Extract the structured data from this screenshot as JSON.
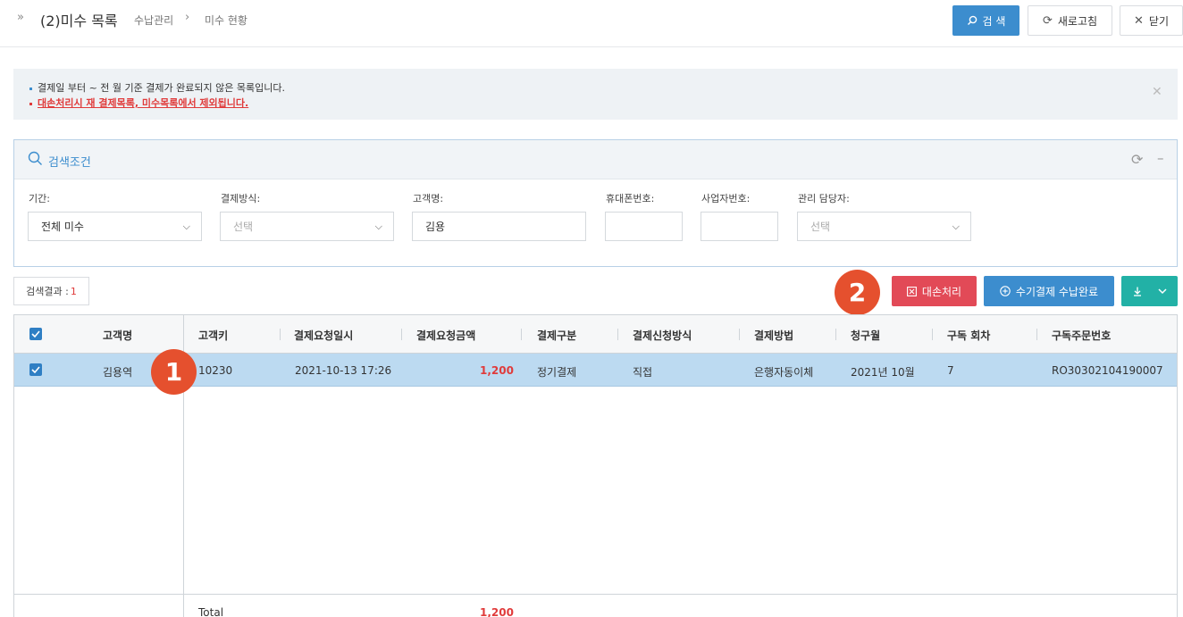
{
  "header": {
    "title": "(2)미수 목록",
    "breadcrumb": [
      "수납관리",
      "미수 현황"
    ],
    "search_label": "검 색",
    "refresh_label": "새로고침",
    "close_label": "닫기"
  },
  "notice": {
    "line1": "결제일 부터 ~ 전 월 기준 결제가 완료되지 않은 목록입니다.",
    "line2": "대손처리시 재 결제목록, 미수목록에서 제외됩니다."
  },
  "search_panel": {
    "title": "검색조건",
    "fields": [
      {
        "label": "기간:",
        "value": "전체 미수",
        "type": "select"
      },
      {
        "label": "결제방식:",
        "value": "선택",
        "type": "select",
        "placeholder": true
      },
      {
        "label": "고객명:",
        "value": "김용",
        "type": "input"
      },
      {
        "label": "휴대폰번호:",
        "value": "",
        "type": "input"
      },
      {
        "label": "사업자번호:",
        "value": "",
        "type": "input"
      },
      {
        "label": "관리 담당자:",
        "value": "선택",
        "type": "select",
        "placeholder": true
      }
    ]
  },
  "results": {
    "count_label": "검색결과 :",
    "count": "1",
    "daeson_label": "대손처리",
    "manual_label": "수기결제 수납완료"
  },
  "badges": [
    "1",
    "2"
  ],
  "grid": {
    "columns": [
      "고객명",
      "고객키",
      "결제요청일시",
      "결제요청금액",
      "결제구분",
      "결제신청방식",
      "결제방법",
      "청구월",
      "구독 회차",
      "구독주문번호"
    ],
    "rows": [
      [
        "김용역",
        "10230",
        "2021-10-13 17:26",
        "1,200",
        "정기결제",
        "직접",
        "은행자동이체",
        "2021년 10월",
        "7",
        "RO30302104190007"
      ]
    ],
    "footer": {
      "label": "Total",
      "amount": "1,200"
    }
  },
  "colors": {
    "primary": "#3c8dce",
    "danger": "#e24a57",
    "teal": "#22b1a6",
    "selected_row": "#bcdaf1",
    "badge": "#e5502e"
  }
}
